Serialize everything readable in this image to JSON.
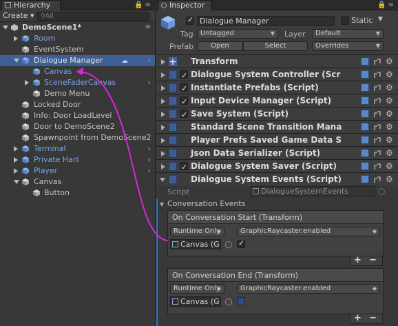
{
  "colors": {
    "accent": "#3e5f96",
    "link_blue": "#7aa3e6",
    "arrow": "#d827d8"
  },
  "hierarchy": {
    "tab_label": "Hierarchy",
    "create_label": "Create ▾",
    "search_placeholder": "All",
    "scene_label": "DemoScene1*",
    "items": [
      {
        "label": "Room",
        "blue": true
      },
      {
        "label": "EventSystem",
        "blue": false
      },
      {
        "label": "Dialogue Manager",
        "blue": false,
        "selected": true
      },
      {
        "label": "Canvas",
        "blue": true
      },
      {
        "label": "SceneFaderCanvas",
        "blue": true
      },
      {
        "label": "Demo Menu",
        "blue": false
      },
      {
        "label": "Locked Door",
        "blue": false
      },
      {
        "label": "Info: Door LoadLevel",
        "blue": false
      },
      {
        "label": "Door to DemoScene2",
        "blue": false
      },
      {
        "label": "Spawnpoint from DemoScene2",
        "blue": false
      },
      {
        "label": "Terminal",
        "blue": true
      },
      {
        "label": "Private Hart",
        "blue": true
      },
      {
        "label": "Player",
        "blue": true
      },
      {
        "label": "Canvas",
        "blue": false
      },
      {
        "label": "Button",
        "blue": false
      }
    ]
  },
  "inspector": {
    "tab_label": "Inspector",
    "object_name": "Dialogue Manager",
    "static_label": "Static",
    "tag_label": "Tag",
    "tag_value": "Untagged",
    "layer_label": "Layer",
    "layer_value": "Default",
    "prefab_label": "Prefab",
    "open_label": "Open",
    "select_label": "Select",
    "overrides_label": "Overrides",
    "components": [
      {
        "title": "Transform",
        "checkbox": false
      },
      {
        "title": "Dialogue System Controller (Scr",
        "checkbox": true
      },
      {
        "title": "Instantiate Prefabs (Script)",
        "checkbox": true
      },
      {
        "title": "Input Device Manager (Script)",
        "checkbox": true
      },
      {
        "title": "Save System (Script)",
        "checkbox": true
      },
      {
        "title": "Standard Scene Transition Mana",
        "checkbox": false
      },
      {
        "title": "Player Prefs Saved Game Data S",
        "checkbox": false
      },
      {
        "title": "Json Data Serializer (Script)",
        "checkbox": false
      },
      {
        "title": "Dialogue System Saver (Script)",
        "checkbox": true
      },
      {
        "title": "Dialogue System Events (Script)",
        "checkbox": false
      }
    ],
    "script_label": "Script",
    "script_value": "DialogueSystemEvents",
    "conversation_events_label": "Conversation Events",
    "events": [
      {
        "title": "On Conversation Start (Transform)",
        "runtime": "Runtime Only",
        "function": "GraphicRaycaster.enabled",
        "object": "Canvas (G"
      },
      {
        "title": "On Conversation End (Transform)",
        "runtime": "Runtime Only",
        "function": "GraphicRaycaster.enabled",
        "object": "Canvas (G"
      }
    ],
    "plus": "+",
    "minus": "−"
  }
}
